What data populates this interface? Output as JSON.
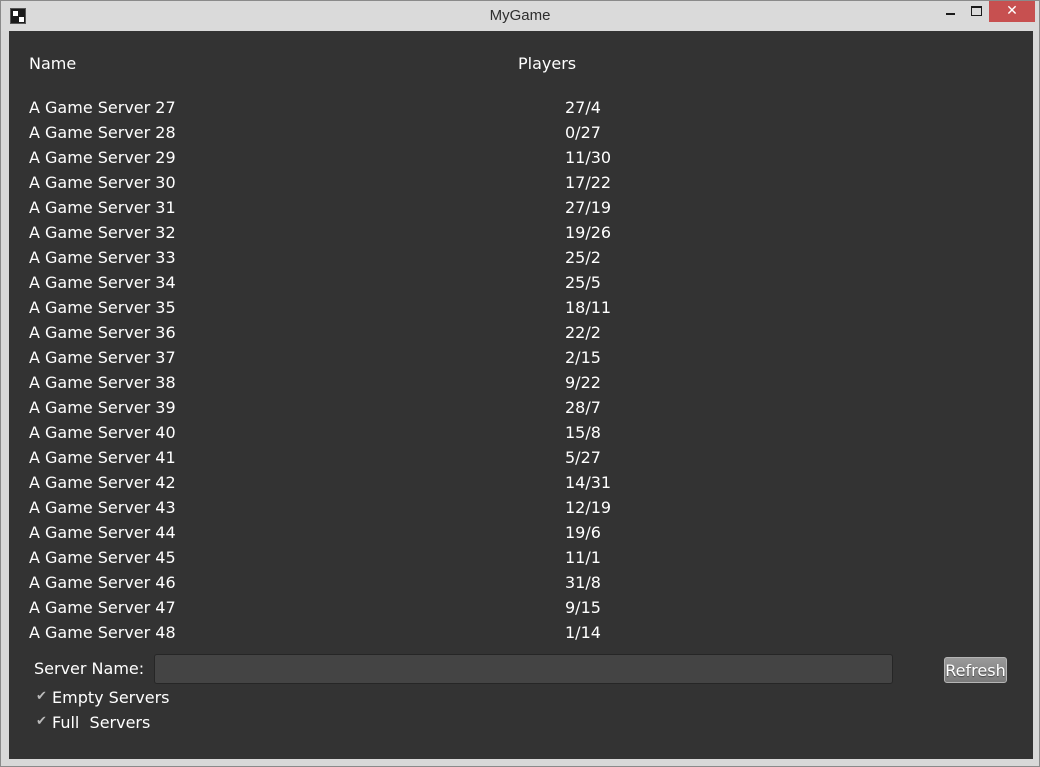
{
  "window": {
    "title": "MyGame",
    "minimize_glyph": "",
    "maximize_glyph": "",
    "close_glyph": "✕",
    "app_icon": "game-logo-icon"
  },
  "columns": {
    "name": "Name",
    "players": "Players"
  },
  "servers": [
    {
      "name": "A Game Server 27",
      "players": "27/4"
    },
    {
      "name": "A Game Server 28",
      "players": "0/27"
    },
    {
      "name": "A Game Server 29",
      "players": "11/30"
    },
    {
      "name": "A Game Server 30",
      "players": "17/22"
    },
    {
      "name": "A Game Server 31",
      "players": "27/19"
    },
    {
      "name": "A Game Server 32",
      "players": "19/26"
    },
    {
      "name": "A Game Server 33",
      "players": "25/2"
    },
    {
      "name": "A Game Server 34",
      "players": "25/5"
    },
    {
      "name": "A Game Server 35",
      "players": "18/11"
    },
    {
      "name": "A Game Server 36",
      "players": "22/2"
    },
    {
      "name": "A Game Server 37",
      "players": "2/15"
    },
    {
      "name": "A Game Server 38",
      "players": "9/22"
    },
    {
      "name": "A Game Server 39",
      "players": "28/7"
    },
    {
      "name": "A Game Server 40",
      "players": "15/8"
    },
    {
      "name": "A Game Server 41",
      "players": "5/27"
    },
    {
      "name": "A Game Server 42",
      "players": "14/31"
    },
    {
      "name": "A Game Server 43",
      "players": "12/19"
    },
    {
      "name": "A Game Server 44",
      "players": "19/6"
    },
    {
      "name": "A Game Server 45",
      "players": "11/1"
    },
    {
      "name": "A Game Server 46",
      "players": "31/8"
    },
    {
      "name": "A Game Server 47",
      "players": "9/15"
    },
    {
      "name": "A Game Server 48",
      "players": "1/14"
    }
  ],
  "filter": {
    "server_name_label": "Server Name:",
    "server_name_value": "",
    "server_name_placeholder": "",
    "refresh_label": "Refresh",
    "empty_servers_label": "Empty Servers",
    "empty_servers_checked": true,
    "full_servers_label": "Full  Servers",
    "full_servers_checked": true,
    "check_glyph": "✔"
  },
  "colors": {
    "panel_background": "#333333",
    "text": "#ffffff",
    "close_button": "#c75050",
    "titlebar": "#dadada"
  }
}
